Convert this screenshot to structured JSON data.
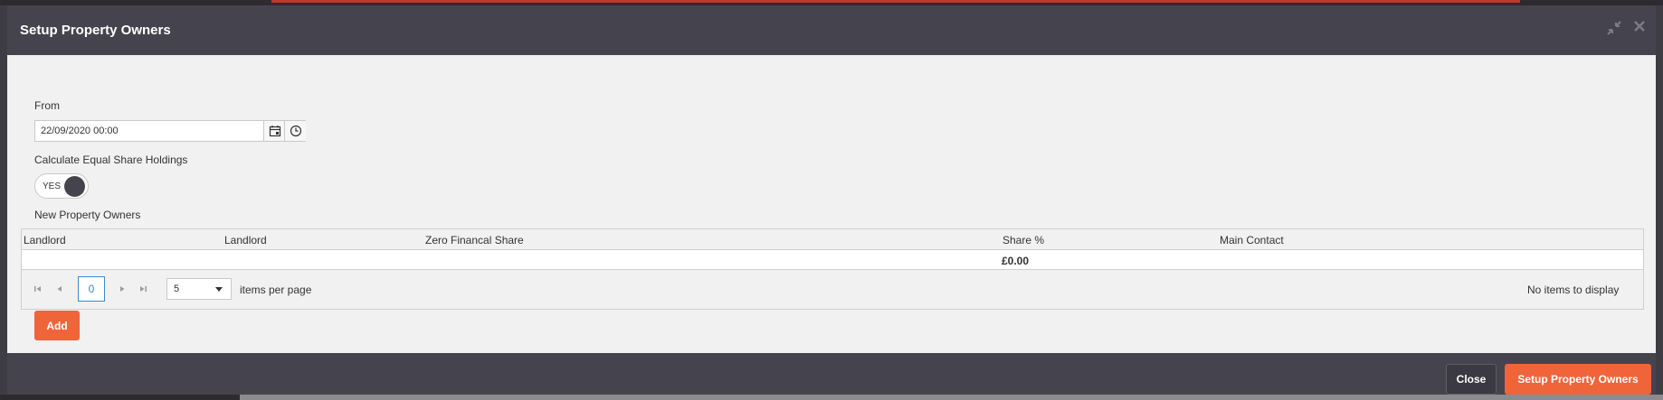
{
  "modal": {
    "title": "Setup Property Owners"
  },
  "form": {
    "from_label": "From",
    "from_value": "22/09/2020 00:00",
    "equal_share_label": "Calculate Equal Share Holdings",
    "equal_share_toggle": "YES",
    "new_owners_label": "New Property Owners"
  },
  "grid": {
    "columns": [
      "Landlord",
      "Landlord",
      "Zero Financal Share",
      "Share %",
      "Main Contact"
    ],
    "total": "£0.00",
    "pager": {
      "page": "0",
      "page_size": "5",
      "items_per_page": "items per page",
      "empty_message": "No items to display"
    }
  },
  "buttons": {
    "add": "Add",
    "close": "Close",
    "setup": "Setup Property Owners"
  },
  "colors": {
    "header_bg": "#45444e",
    "accent": "#f0643a",
    "body_bg": "#f1f1f1",
    "pager_active": "#3b8bd1"
  }
}
